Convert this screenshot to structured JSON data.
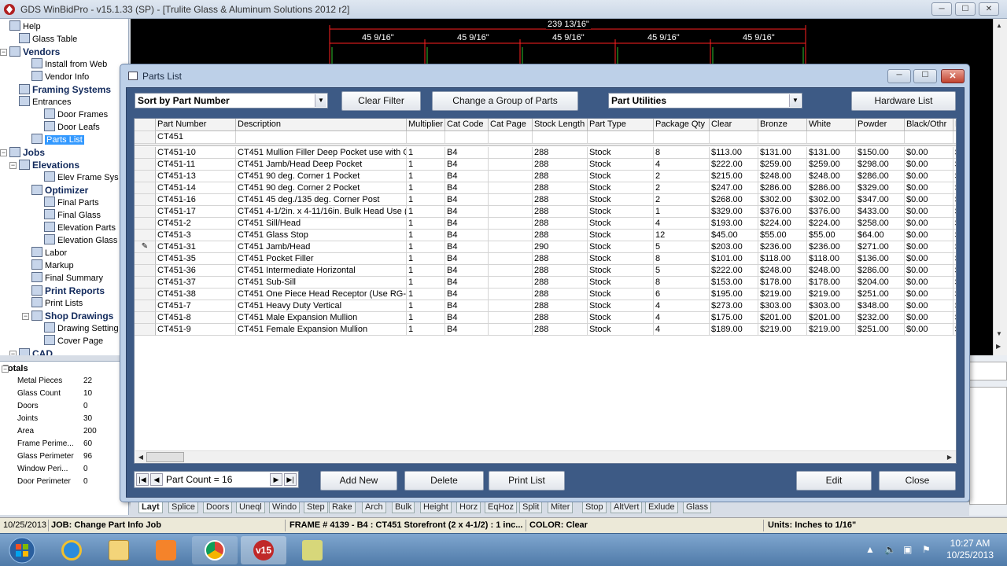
{
  "window": {
    "title": "GDS WinBidPro - v15.1.33 (SP) - [Trulite Glass & Aluminum Solutions 2012 r2]",
    "min": "─",
    "max": "☐",
    "close": "✕"
  },
  "tree": [
    {
      "label": "Help",
      "depth": 0,
      "bold": false,
      "icon": "help-icon"
    },
    {
      "label": "Glass Table",
      "depth": 1,
      "bold": false,
      "icon": "table-icon"
    },
    {
      "label": "Vendors",
      "depth": 0,
      "bold": true,
      "icon": "vendors-icon"
    },
    {
      "label": "Install from Web",
      "depth": 2,
      "bold": false,
      "icon": "web-icon"
    },
    {
      "label": "Vendor Info",
      "depth": 2,
      "bold": false,
      "icon": "info-icon"
    },
    {
      "label": "Framing Systems",
      "depth": 1,
      "bold": true,
      "icon": "framing-icon"
    },
    {
      "label": "Entrances",
      "depth": 1,
      "bold": false,
      "icon": "entrance-icon"
    },
    {
      "label": "Door Frames",
      "depth": 3,
      "bold": false,
      "icon": "door-frame-icon"
    },
    {
      "label": "Door Leafs",
      "depth": 3,
      "bold": false,
      "icon": "door-leaf-icon"
    },
    {
      "label": "Parts List",
      "depth": 2,
      "bold": false,
      "icon": "parts-icon",
      "selected": true
    },
    {
      "label": "Jobs",
      "depth": 0,
      "bold": true,
      "icon": "jobs-icon"
    },
    {
      "label": "Elevations",
      "depth": 1,
      "bold": true,
      "icon": "elevations-icon"
    },
    {
      "label": "Elev Frame Sys",
      "depth": 3,
      "bold": false,
      "icon": "frame-sys-icon"
    },
    {
      "label": "Optimizer",
      "depth": 2,
      "bold": true,
      "icon": "optimizer-icon"
    },
    {
      "label": "Final Parts",
      "depth": 3,
      "bold": false,
      "icon": "final-parts-icon"
    },
    {
      "label": "Final Glass",
      "depth": 3,
      "bold": false,
      "icon": "final-glass-icon"
    },
    {
      "label": "Elevation Parts",
      "depth": 3,
      "bold": false,
      "icon": "elev-parts-icon"
    },
    {
      "label": "Elevation Glass",
      "depth": 3,
      "bold": false,
      "icon": "elev-glass-icon"
    },
    {
      "label": "Labor",
      "depth": 2,
      "bold": false,
      "icon": "labor-icon"
    },
    {
      "label": "Markup",
      "depth": 2,
      "bold": false,
      "icon": "markup-icon"
    },
    {
      "label": "Final Summary",
      "depth": 2,
      "bold": false,
      "icon": "summary-icon"
    },
    {
      "label": "Print Reports",
      "depth": 2,
      "bold": true,
      "icon": "print-icon"
    },
    {
      "label": "Print Lists",
      "depth": 2,
      "bold": false,
      "icon": "print-lists-icon"
    },
    {
      "label": "Shop Drawings",
      "depth": 2,
      "bold": true,
      "icon": "shop-drawings-icon"
    },
    {
      "label": "Drawing Setting",
      "depth": 3,
      "bold": false,
      "icon": "drawing-setting-icon"
    },
    {
      "label": "Cover Page",
      "depth": 3,
      "bold": false,
      "icon": "cover-page-icon"
    },
    {
      "label": "CAD",
      "depth": 1,
      "bold": true,
      "icon": "cad-icon"
    }
  ],
  "totals": {
    "header": "Totals",
    "rows": [
      {
        "k": "Metal Pieces",
        "v": "22"
      },
      {
        "k": "Glass Count",
        "v": "10"
      },
      {
        "k": "Doors",
        "v": "0"
      },
      {
        "k": "Joints",
        "v": "30"
      },
      {
        "k": "Area",
        "v": "200"
      },
      {
        "k": "Frame Perime...",
        "v": "60"
      },
      {
        "k": "Glass Perimeter",
        "v": "96"
      },
      {
        "k": "Window Peri...",
        "v": "0"
      },
      {
        "k": "Door Perimeter",
        "v": "0"
      }
    ]
  },
  "drawing": {
    "overall": "239 13/16\"",
    "segments": [
      "45 9/16\"",
      "45 9/16\"",
      "45 9/16\"",
      "45 9/16\"",
      "45 9/16\""
    ]
  },
  "dialog": {
    "title": "Parts List",
    "sort": "Sort by Part Number",
    "clear_filter": "Clear Filter",
    "change_group": "Change a Group of Parts",
    "utilities": "Part Utilities",
    "hardware": "Hardware List",
    "add_new": "Add New",
    "delete": "Delete",
    "print_list": "Print List",
    "edit": "Edit",
    "close": "Close",
    "part_count": "Part Count = 16",
    "filter_value": "CT451"
  },
  "grid": {
    "columns": [
      "Part Number",
      "Description",
      "Multiplier",
      "Cat Code",
      "Cat Page",
      "Stock Length",
      "Part Type",
      "Package Qty",
      "Clear",
      "Bronze",
      "White",
      "Powder",
      "Black/Othr",
      "M"
    ],
    "rows": [
      [
        "CT451-10",
        "CT451 Mullion Filler Deep Pocket use with CT",
        "1",
        "B4",
        "",
        "288",
        "Stock",
        "8",
        "$113.00",
        "$131.00",
        "$131.00",
        "$150.00",
        "$0.00",
        "$"
      ],
      [
        "CT451-11",
        "CT451 Jamb/Head Deep Pocket",
        "1",
        "B4",
        "",
        "288",
        "Stock",
        "4",
        "$222.00",
        "$259.00",
        "$259.00",
        "$298.00",
        "$0.00",
        "$"
      ],
      [
        "CT451-13",
        "CT451 90 deg. Corner 1 Pocket",
        "1",
        "B4",
        "",
        "288",
        "Stock",
        "2",
        "$215.00",
        "$248.00",
        "$248.00",
        "$286.00",
        "$0.00",
        "$"
      ],
      [
        "CT451-14",
        "CT451 90 deg. Corner 2 Pocket",
        "1",
        "B4",
        "",
        "288",
        "Stock",
        "2",
        "$247.00",
        "$286.00",
        "$286.00",
        "$329.00",
        "$0.00",
        "$"
      ],
      [
        "CT451-16",
        "CT451 45 deg./135 deg. Corner Post",
        "1",
        "B4",
        "",
        "288",
        "Stock",
        "2",
        "$268.00",
        "$302.00",
        "$302.00",
        "$347.00",
        "$0.00",
        "$"
      ],
      [
        "CT451-17",
        "CT451 4-1/2in. x 4-11/16in. Bulk Head Use (",
        "1",
        "B4",
        "",
        "288",
        "Stock",
        "1",
        "$329.00",
        "$376.00",
        "$376.00",
        "$433.00",
        "$0.00",
        "$"
      ],
      [
        "CT451-2",
        "CT451 Sill/Head",
        "1",
        "B4",
        "",
        "288",
        "Stock",
        "4",
        "$193.00",
        "$224.00",
        "$224.00",
        "$258.00",
        "$0.00",
        "$"
      ],
      [
        "CT451-3",
        "CT451 Glass Stop",
        "1",
        "B4",
        "",
        "288",
        "Stock",
        "12",
        "$45.00",
        "$55.00",
        "$55.00",
        "$64.00",
        "$0.00",
        "$"
      ],
      [
        "CT451-31",
        "CT451 Jamb/Head",
        "1",
        "B4",
        "",
        "290",
        "Stock",
        "5",
        "$203.00",
        "$236.00",
        "$236.00",
        "$271.00",
        "$0.00",
        "$"
      ],
      [
        "CT451-35",
        "CT451 Pocket Filler",
        "1",
        "B4",
        "",
        "288",
        "Stock",
        "8",
        "$101.00",
        "$118.00",
        "$118.00",
        "$136.00",
        "$0.00",
        "$"
      ],
      [
        "CT451-36",
        "CT451 Intermediate Horizontal",
        "1",
        "B4",
        "",
        "288",
        "Stock",
        "5",
        "$222.00",
        "$248.00",
        "$248.00",
        "$286.00",
        "$0.00",
        "$"
      ],
      [
        "CT451-37",
        "CT451 Sub-Sill",
        "1",
        "B4",
        "",
        "288",
        "Stock",
        "8",
        "$153.00",
        "$178.00",
        "$178.00",
        "$204.00",
        "$0.00",
        "$"
      ],
      [
        "CT451-38",
        "CT451 One Piece Head Receptor (Use RG-1",
        "1",
        "B4",
        "",
        "288",
        "Stock",
        "6",
        "$195.00",
        "$219.00",
        "$219.00",
        "$251.00",
        "$0.00",
        "$"
      ],
      [
        "CT451-7",
        "CT451 Heavy Duty Vertical",
        "1",
        "B4",
        "",
        "288",
        "Stock",
        "4",
        "$273.00",
        "$303.00",
        "$303.00",
        "$348.00",
        "$0.00",
        "$"
      ],
      [
        "CT451-8",
        "CT451 Male Expansion Mullion",
        "1",
        "B4",
        "",
        "288",
        "Stock",
        "4",
        "$175.00",
        "$201.00",
        "$201.00",
        "$232.00",
        "$0.00",
        "$"
      ],
      [
        "CT451-9",
        "CT451 Female Expansion Mullion",
        "1",
        "B4",
        "",
        "288",
        "Stock",
        "4",
        "$189.00",
        "$219.00",
        "$219.00",
        "$251.00",
        "$0.00",
        "$"
      ]
    ],
    "edit_row_index": 8
  },
  "tabs": [
    "Layt",
    "Splice",
    "Doors",
    "Uneql",
    "Windo",
    "Step",
    "Rake",
    "Arch",
    "Bulk",
    "Height",
    "Horz",
    "EqHoz",
    "Split",
    "Miter",
    "Stop",
    "AltVert",
    "Exlude",
    "Glass"
  ],
  "status": {
    "date": "10/25/2013",
    "job_label": "JOB:",
    "job_text": "Change Part Info Job",
    "frame": "FRAME # 4139 - B4 : CT451 Storefront (2 x 4-1/2) : 1 inc...",
    "color": "COLOR: Clear",
    "units": "Units: Inches to 1/16\""
  },
  "taskbar": {
    "time": "10:27 AM",
    "date": "10/25/2013",
    "v15": "v15"
  },
  "colors": {
    "dialog_bg": "#bdd0e8",
    "dialog_inner": "#3d5a85",
    "drawing_bg": "#000000",
    "dimension_line": "#ff2020",
    "selected": "#3399ff"
  }
}
